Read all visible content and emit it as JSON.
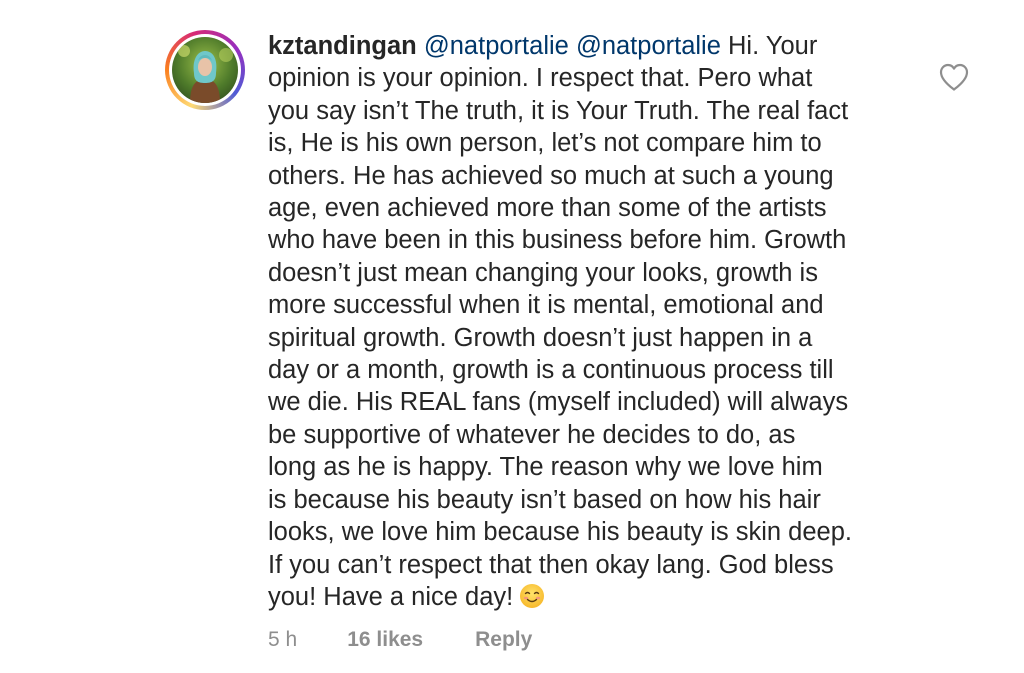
{
  "comment": {
    "username": "kztandingan",
    "mentions": [
      "@natportalie",
      "@natportalie"
    ],
    "lines": [
      "Hi. Your",
      "opinion is your opinion. I respect that. Pero what",
      "you say isn’t The truth, it is Your Truth. The real fact",
      "is, He is his own person, let’s not compare him to",
      "others. He has achieved so much at such a young",
      "age, even achieved more than some of the artists",
      "who have been in this business before him. Growth",
      "doesn’t just mean changing your looks, growth is",
      "more successful when it is mental, emotional and",
      "spiritual growth. Growth doesn’t just happen in a",
      "day or a month, growth is a continuous process till",
      "we die. His REAL fans (myself included) will always",
      "be supportive of whatever he decides to do, as",
      "long as he is happy.  The reason why we love him",
      "is because his beauty isn’t based on how his hair",
      "looks, we love him because his beauty is skin deep.",
      "If you can’t respect that then okay lang. God bless",
      "you! Have a nice day!"
    ],
    "emoji": "smiling-face-with-smiling-eyes"
  },
  "meta": {
    "time": "5 h",
    "likes": "16 likes",
    "reply": "Reply"
  },
  "icons": {
    "like": "heart-outline-icon"
  },
  "colors": {
    "text": "#262626",
    "secondary": "#8e8e8e",
    "mention": "#00376b"
  }
}
